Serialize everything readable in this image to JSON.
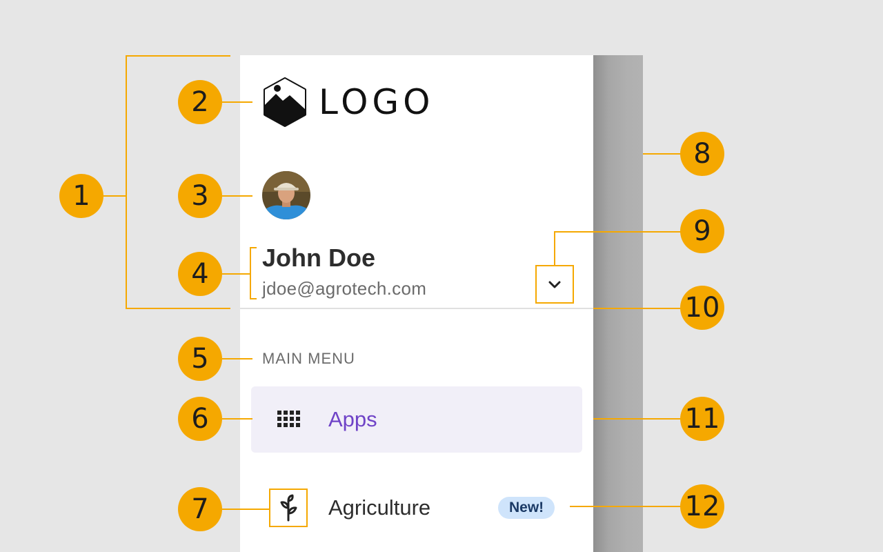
{
  "drawer": {
    "logo": {
      "text": "LOGO",
      "icon": "mountain-hexagon-logo"
    },
    "user": {
      "name": "John Doe",
      "email": "jdoe@agrotech.com",
      "avatar": "user-avatar-photo"
    },
    "account_toggle_icon": "chevron-down-icon",
    "section_header": "MAIN MENU",
    "nav": [
      {
        "label": "Apps",
        "icon": "apps-grid-icon",
        "active": true
      },
      {
        "label": "Agriculture",
        "icon": "sprout-icon",
        "active": false,
        "badge": "New!"
      }
    ]
  },
  "callouts": [
    "1",
    "2",
    "3",
    "4",
    "5",
    "6",
    "7",
    "8",
    "9",
    "10",
    "11",
    "12"
  ],
  "colors": {
    "background": "#e6e6e6",
    "drawer": "#ffffff",
    "scrim": "#b2b2b2",
    "callout": "#f5a800",
    "active_item_bg": "#f1eff8",
    "active_item_text": "#6f43c7",
    "badge_bg": "#cfe4fb",
    "badge_text": "#1b3a66"
  }
}
